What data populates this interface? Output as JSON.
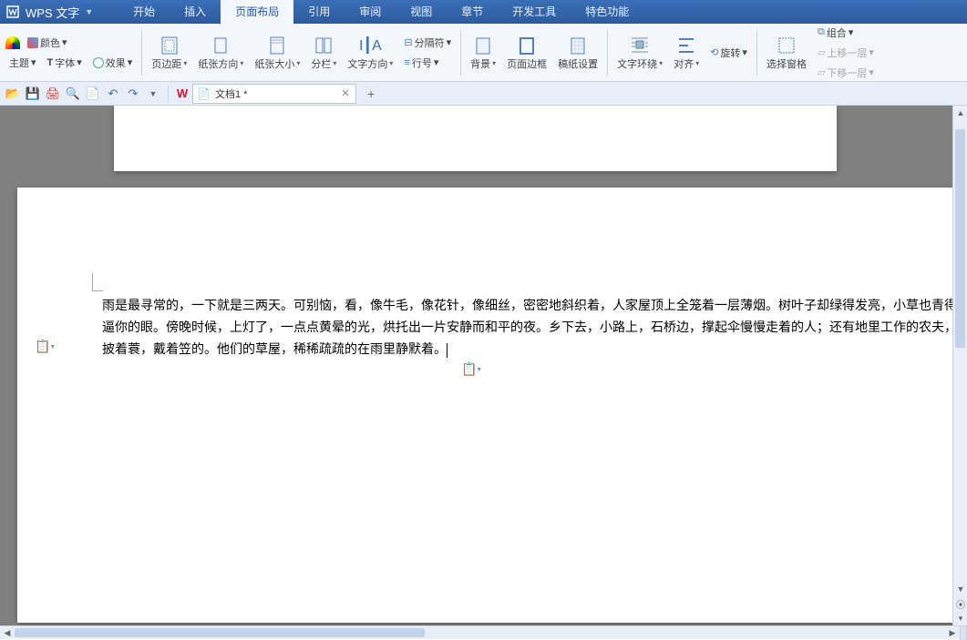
{
  "app": {
    "name": "WPS 文字"
  },
  "menu": {
    "items": [
      "开始",
      "插入",
      "页面布局",
      "引用",
      "审阅",
      "视图",
      "章节",
      "开发工具",
      "特色功能"
    ],
    "active_index": 2
  },
  "ribbon": {
    "theme": {
      "colors": "颜色",
      "theme": "主题",
      "fonts": "字体",
      "effects": "效果"
    },
    "page": {
      "margins": "页边距",
      "orientation": "纸张方向",
      "size": "纸张大小",
      "columns": "分栏",
      "direction": "文字方向"
    },
    "breaks": {
      "break": "分隔符",
      "line_no": "行号"
    },
    "bg": {
      "background": "背景",
      "border": "页面边框",
      "draft": "稿纸设置"
    },
    "arrange": {
      "wrap": "文字环绕",
      "align": "对齐",
      "rotate": "旋转",
      "select_pane": "选择窗格",
      "group": "组合",
      "bring_fwd": "上移一层",
      "send_back": "下移一层"
    }
  },
  "tabs": {
    "doc_label": "文档1 *"
  },
  "document": {
    "paragraph": "雨是最寻常的，一下就是三两天。可别恼，看，像牛毛，像花针，像细丝，密密地斜织着，人家屋顶上全笼着一层薄烟。树叶子却绿得发亮，小草也青得逼你的眼。傍晚时候，上灯了，一点点黄晕的光，烘托出一片安静而和平的夜。乡下去，小路上，石桥边，撑起伞慢慢走着的人；还有地里工作的农夫，披着蓑，戴着笠的。他们的草屋，稀稀疏疏的在雨里静默着。"
  }
}
